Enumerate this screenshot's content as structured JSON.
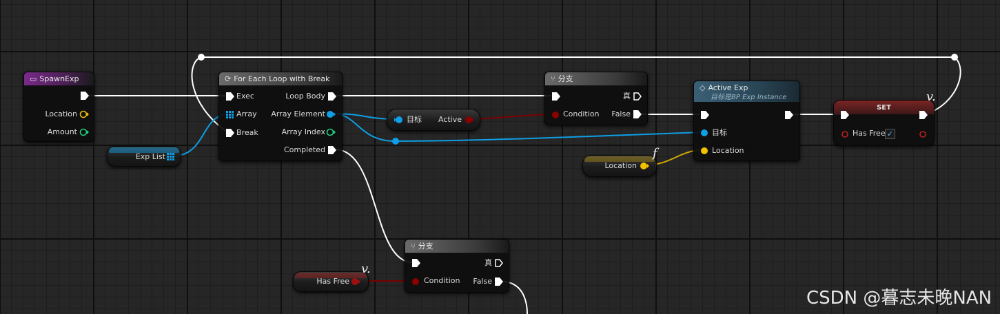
{
  "nodes": {
    "spawn_exp": {
      "title": "SpawnExp",
      "pins": {
        "location": "Location",
        "amount": "Amount"
      }
    },
    "for_each": {
      "title": "For Each Loop with Break",
      "pins": {
        "exec": "Exec",
        "array": "Array",
        "break": "Break",
        "loop_body": "Loop Body",
        "array_element": "Array Element",
        "array_index": "Array Index",
        "completed": "Completed"
      }
    },
    "branch_top": {
      "title": "分支",
      "true_label": "真",
      "condition": "Condition",
      "false_label": "False"
    },
    "active_exp": {
      "title": "Active Exp",
      "subtitle": "目标是BP Exp Instance",
      "target": "目标",
      "location": "Location"
    },
    "set_node": {
      "title": "SET",
      "pin": "Has Free",
      "checked": true
    },
    "branch_bottom": {
      "title": "分支",
      "true_label": "真",
      "condition": "Condition",
      "false_label": "False"
    },
    "target_active": {
      "target": "目标",
      "output": "Active"
    }
  },
  "variables": {
    "exp_list": "Exp List",
    "location": "Location",
    "has_free": "Has Free"
  },
  "symbols": {
    "var_symbol": "v.",
    "func_symbol": "f"
  },
  "colors": {
    "exec": "#ffffff",
    "object": "#0e9fe6",
    "bool": "#8b0000",
    "vector": "#f2c200",
    "int": "#1fd182",
    "event_header": "#7a2a8a",
    "function_header": "#3a5f75"
  },
  "watermark": "CSDN @暮志未晚NAN"
}
